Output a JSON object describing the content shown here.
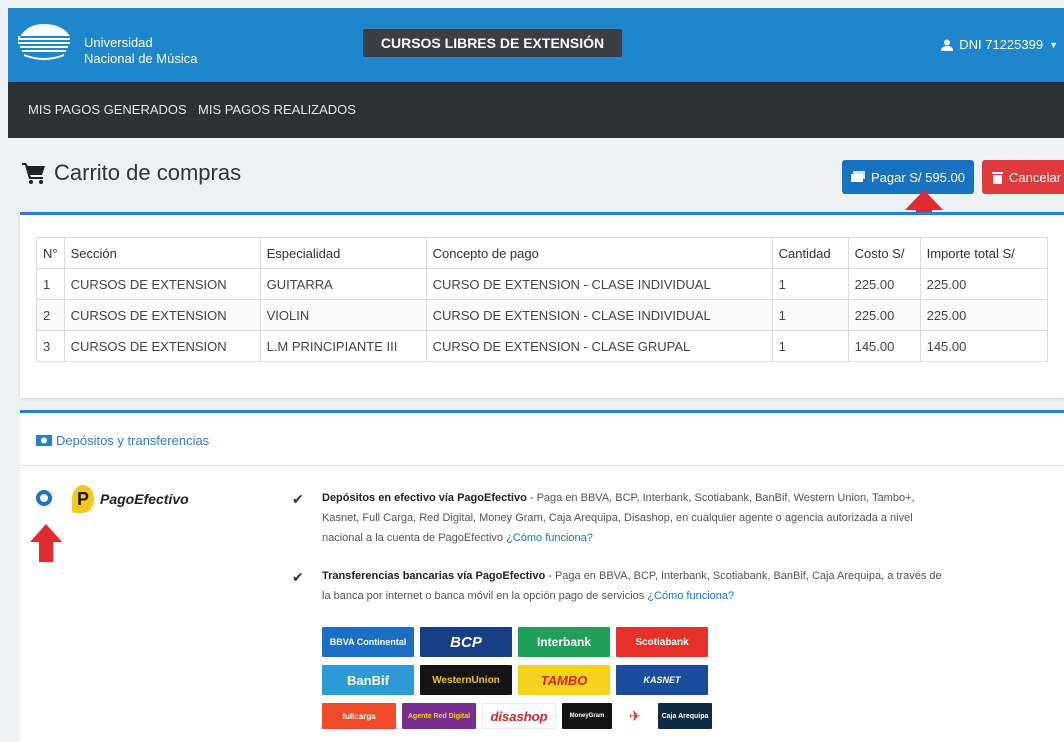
{
  "header": {
    "university_line1": "Universidad",
    "university_line2": "Nacional de Música",
    "title": "CURSOS LIBRES DE EXTENSIÓN",
    "user_label": "DNI 71225399",
    "accent_color": "#1f86cc"
  },
  "nav": {
    "items": [
      {
        "label": "MIS PAGOS GENERADOS"
      },
      {
        "label": "MIS PAGOS REALIZADOS"
      }
    ]
  },
  "page": {
    "title": "Carrito de compras",
    "pay_button": "Pagar S/ 595.00",
    "cancel_button": "Cancelar"
  },
  "table": {
    "columns": [
      "N°",
      "Sección",
      "Especialidad",
      "Concepto de pago",
      "Cantidad",
      "Costo S/",
      "Importe total S/"
    ],
    "rows": [
      [
        "1",
        "CURSOS DE EXTENSION",
        "GUITARRA",
        "CURSO DE EXTENSION - CLASE INDIVIDUAL",
        "1",
        "225.00",
        "225.00"
      ],
      [
        "2",
        "CURSOS DE EXTENSION",
        "VIOLIN",
        "CURSO DE EXTENSION - CLASE INDIVIDUAL",
        "1",
        "225.00",
        "225.00"
      ],
      [
        "3",
        "CURSOS DE EXTENSION",
        "L.M PRINCIPIANTE III",
        "CURSO DE EXTENSION - CLASE GRUPAL",
        "1",
        "145.00",
        "145.00"
      ]
    ]
  },
  "payment": {
    "header": "Depósitos y transferencias",
    "provider": "PagoEfectivo",
    "option1_title": "Depósitos en efectivo vía PagoEfectivo",
    "option1_text": " - Paga en BBVA, BCP, Interbank, Scotiabank, BanBif, Western Union, Tambo+, Kasnet, Full Carga, Red Digital, Money Gram, Caja Arequipa, Disashop, en cualquier agente o agencia autorizada a nivel nacional a la cuenta de PagoEfectivo ",
    "option1_link": "¿Cómo funciona?",
    "option2_title": "Transferencias bancarias vía PagoEfectivo",
    "option2_text": " - Paga en BBVA, BCP, Interbank, Scotiabank, BanBif, Caja Arequipa, a través de la banca por internet o banca móvil en la opción pago de servicios ",
    "option2_link": "¿Cómo funciona?",
    "banks": [
      {
        "name": "BBVA Continental",
        "color": "#1a6fc4"
      },
      {
        "name": "BCP",
        "color": "#173f87"
      },
      {
        "name": "Interbank",
        "color": "#1fa05a"
      },
      {
        "name": "Scotiabank",
        "color": "#e8302a"
      },
      {
        "name": "BanBif",
        "color": "#2d9ad8"
      },
      {
        "name": "WesternUnion",
        "color": "#141414"
      },
      {
        "name": "TAMBO",
        "color": "#f5d21e"
      },
      {
        "name": "KASNET",
        "color": "#1a4e9c"
      },
      {
        "name": "fullcarga",
        "color": "#ef4b2a"
      },
      {
        "name": "Agente Red Digital",
        "color": "#7a2e8e"
      },
      {
        "name": "disashop",
        "color": "#ffffff"
      },
      {
        "name": "MoneyGram",
        "color": "#141414"
      },
      {
        "name": "Caja Arequipa",
        "color": "#0f2a44"
      }
    ]
  }
}
